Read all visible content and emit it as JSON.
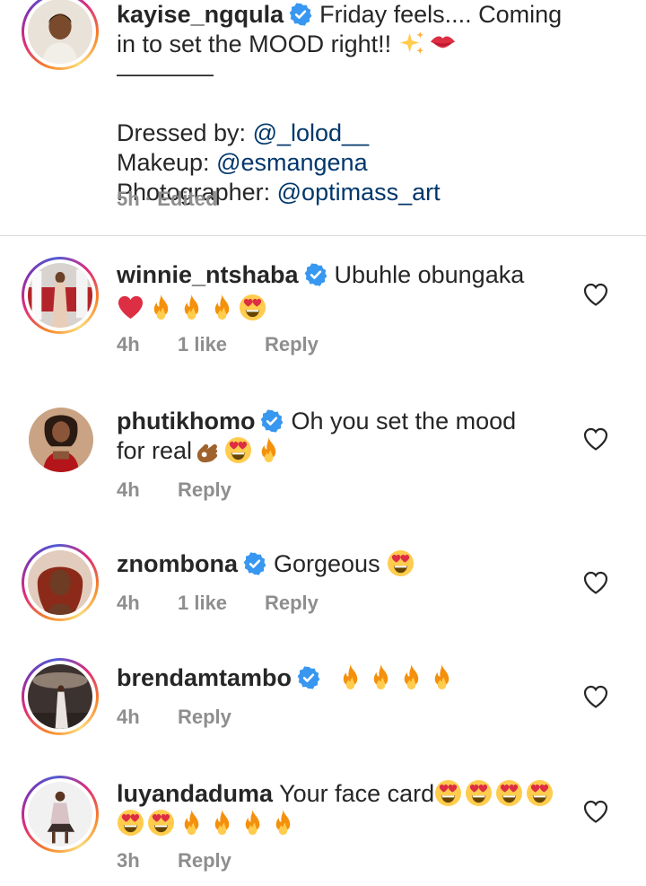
{
  "caption": {
    "username": "kayise_ngqula",
    "text_line1": "Friday feels.... Coming",
    "text_line2": "in to set the MOOD right!!",
    "separator": "————",
    "dressed_label": "Dressed by:",
    "dressed_handle": "@_lolod__",
    "makeup_label": "Makeup:",
    "makeup_handle": "@esmangena",
    "photo_label": "Photographer:",
    "photo_handle": "@optimass_art",
    "meta": "5h · Edited"
  },
  "comments": [
    {
      "username": "winnie_ntshaba",
      "text": "Ubuhle obungaka",
      "time": "4h",
      "likes": "1 like",
      "reply": "Reply"
    },
    {
      "username": "phutikhomo",
      "text": "Oh you set the mood",
      "text2": "for real",
      "time": "4h",
      "reply": "Reply"
    },
    {
      "username": "znombona",
      "text": "Gorgeous",
      "time": "4h",
      "likes": "1 like",
      "reply": "Reply"
    },
    {
      "username": "brendamtambo",
      "text": "",
      "time": "4h",
      "reply": "Reply"
    },
    {
      "username": "luyandaduma",
      "text": "Your face card",
      "time": "3h",
      "reply": "Reply"
    }
  ],
  "icons": {
    "verified": "verified-badge-icon",
    "heart": "heart-outline-icon",
    "emoji_fire": "fire-emoji",
    "emoji_heart_eyes": "heart-eyes-emoji",
    "emoji_red_heart": "red-heart-emoji",
    "emoji_ok_hand": "ok-hand-emoji",
    "emoji_sparkles": "sparkles-emoji",
    "emoji_kiss": "kiss-mark-emoji"
  },
  "colors": {
    "text": "#262626",
    "muted": "#8e8e8e",
    "mention": "#00376b",
    "verified": "#3897f0"
  }
}
